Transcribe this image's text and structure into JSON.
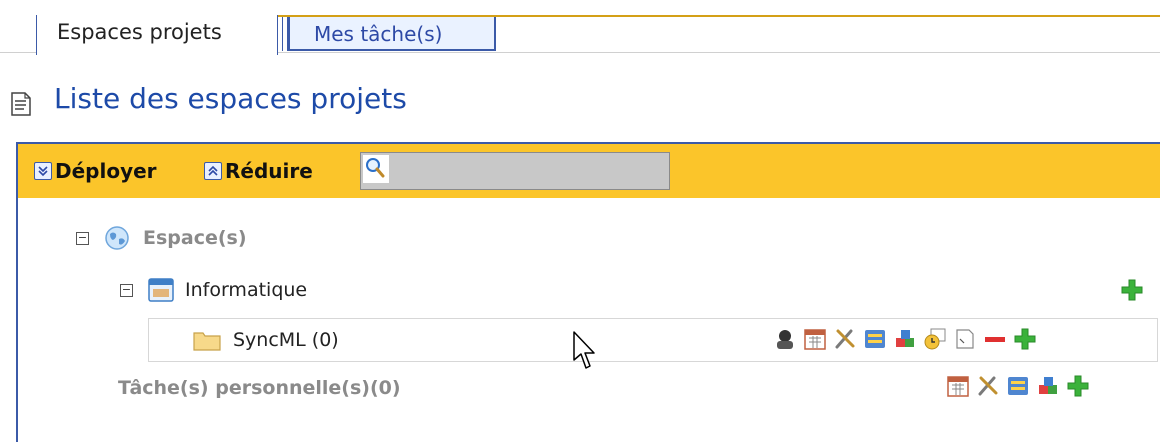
{
  "tabs": [
    {
      "label": "Espaces projets",
      "active": true
    },
    {
      "label": "Mes tâche(s)",
      "active": false
    }
  ],
  "page_title": "Liste des espaces projets",
  "toolbar": {
    "expand_label": "Déployer",
    "collapse_label": "Réduire",
    "search_value": ""
  },
  "tree": {
    "root_label": "Espace(s)",
    "workspace_label": "Informatique",
    "project_label": "SyncML (0)",
    "personal_tasks_label": "Tâche(s) personnelle(s)(0)"
  },
  "colors": {
    "accent_blue": "#1d4aa8",
    "toolbar_yellow": "#fbc52a",
    "add_green": "#3bb23b",
    "remove_red": "#e03030"
  },
  "icons": {
    "project_actions": [
      "user-icon",
      "calendar-icon",
      "tools-icon",
      "list-icon",
      "cubes-icon",
      "clock-icon",
      "note-icon",
      "remove-icon",
      "add-icon"
    ],
    "personal_actions": [
      "calendar-icon",
      "tools-icon",
      "list-icon",
      "cubes-icon",
      "add-icon"
    ]
  }
}
